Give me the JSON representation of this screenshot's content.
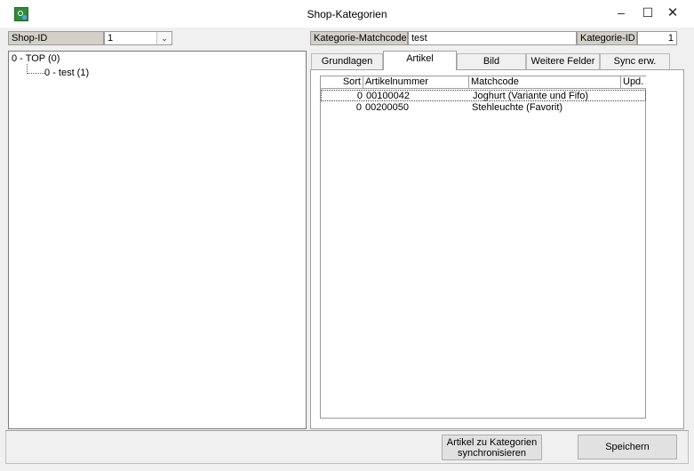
{
  "window": {
    "title": "Shop-Kategorien",
    "minimize_glyph": "–",
    "maximize_glyph": "☐",
    "close_glyph": "✕"
  },
  "left": {
    "shop_id_label": "Shop-ID",
    "shop_id_value": "1",
    "tree": {
      "root": "0 - TOP (0)",
      "child": "0 - test (1)"
    }
  },
  "header": {
    "matchcode_label": "Kategorie-Matchcode",
    "matchcode_value": "test",
    "kategorie_id_label": "Kategorie-ID",
    "kategorie_id_value": "1"
  },
  "tabs": [
    {
      "label": "Grundlagen",
      "active": false
    },
    {
      "label": "Artikel",
      "active": true
    },
    {
      "label": "Bild",
      "active": false
    },
    {
      "label": "Weitere Felder",
      "active": false
    },
    {
      "label": "Sync erw.",
      "active": false
    }
  ],
  "grid": {
    "columns": [
      "Sort",
      "Artikelnummer",
      "Matchcode",
      "Upd."
    ],
    "rows": [
      {
        "sort": "0",
        "artikelnummer": "00100042",
        "matchcode": "Joghurt (Variante und Fifo)"
      },
      {
        "sort": "0",
        "artikelnummer": "00200050",
        "matchcode": "Stehleuchte  (Favorit)"
      }
    ]
  },
  "buttons": {
    "sync_line1": "Artikel zu Kategorien",
    "sync_line2": "synchronisieren",
    "save": "Speichern"
  },
  "icons": {
    "app": "app-icon",
    "dropdown": "chevron-down-icon"
  }
}
